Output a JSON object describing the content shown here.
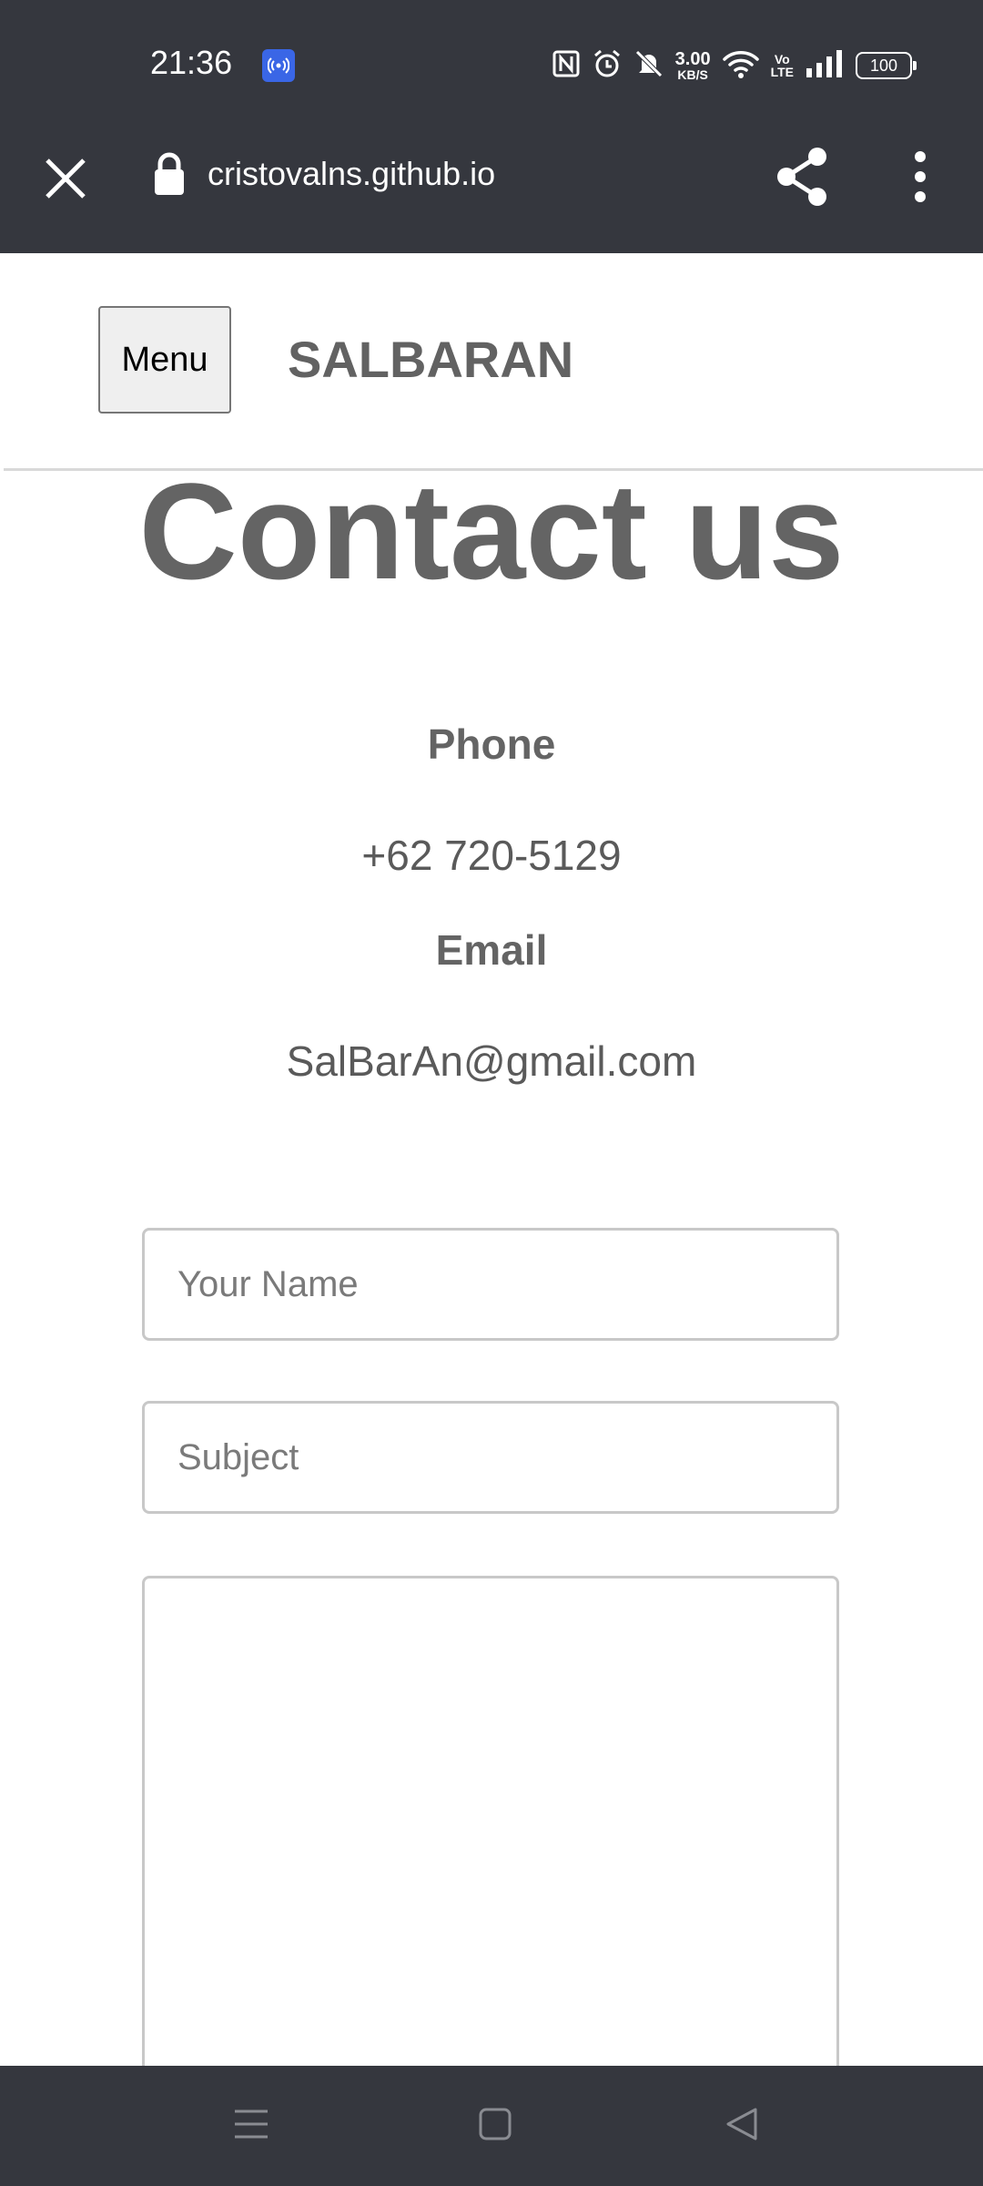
{
  "status_bar": {
    "time": "21:36",
    "net_speed_value": "3.00",
    "net_speed_unit": "KB/S",
    "volte_top": "Vo",
    "volte_bottom": "LTE",
    "battery": "100",
    "icons": [
      "hotspot-icon",
      "nfc-icon",
      "alarm-icon",
      "mute-icon",
      "wifi-icon",
      "volte-icon",
      "signal-icon",
      "battery-icon"
    ]
  },
  "browser": {
    "url": "cristovalns.github.io",
    "icons": [
      "close-icon",
      "lock-icon",
      "share-icon",
      "more-vert-icon"
    ]
  },
  "header": {
    "menu_label": "Menu",
    "brand": "SALBARAN"
  },
  "main": {
    "title": "Contact us",
    "phone_label": "Phone",
    "phone_value": "+62 720-5129",
    "email_label": "Email",
    "email_value": "SalBarAn@gmail.com"
  },
  "form": {
    "name_placeholder": "Your Name",
    "subject_placeholder": "Subject",
    "message_placeholder": ""
  },
  "nav": {
    "icons": [
      "recents-icon",
      "home-icon",
      "back-icon"
    ]
  },
  "colors": {
    "system_bar": "#35373e",
    "text_gray": "#646464",
    "accent_badge": "#3a66e6"
  }
}
